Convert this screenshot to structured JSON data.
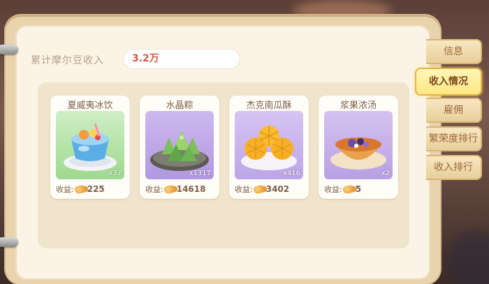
{
  "summary": {
    "label": "累计摩尔豆收入",
    "value": "3.2万"
  },
  "income_prefix": "收益:",
  "items": [
    {
      "name": "夏威夷冰饮",
      "count": "x37",
      "income": "225"
    },
    {
      "name": "水晶粽",
      "count": "x1317",
      "income": "14618"
    },
    {
      "name": "杰克南瓜酥",
      "count": "x416",
      "income": "3402"
    },
    {
      "name": "浆果浓汤",
      "count": "x2",
      "income": "5"
    }
  ],
  "tabs": [
    {
      "label": "信息",
      "active": false
    },
    {
      "label": "收入情况",
      "active": true
    },
    {
      "label": "雇佣",
      "active": false
    },
    {
      "label": "繁荣度排行",
      "active": false
    },
    {
      "label": "收入排行",
      "active": false
    }
  ],
  "colors": {
    "accent": "#d4594a",
    "active_tab": "#ffe682",
    "panel": "#f1e4cc"
  },
  "icons": {
    "currency": "mole-bean-icon"
  }
}
